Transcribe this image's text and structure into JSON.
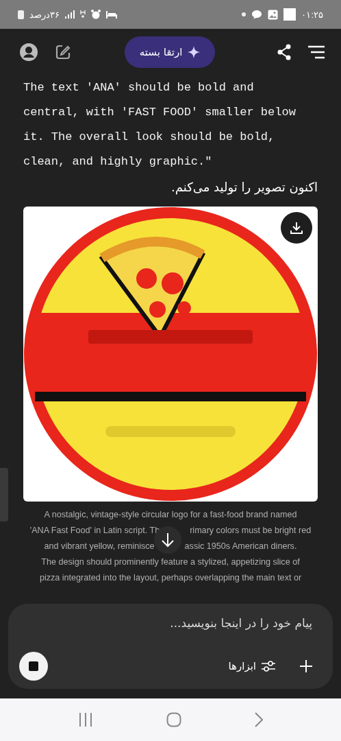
{
  "status_bar": {
    "time": "۰۱:۲۵",
    "battery": "۳۶درصد"
  },
  "header": {
    "upgrade_button": "ارتقا بسته"
  },
  "message": {
    "code_lines": [
      "The text 'ANA' should be bold and",
      "central, with 'FAST FOOD' smaller below",
      "it. The overall look should be bold,",
      "clean, and highly graphic.\""
    ],
    "reply": "اکنون تصویر را تولید می‌کنم.",
    "image": {
      "kind": "picture"
    },
    "caption_lines": [
      {
        "start": "A nostalgic, vintage-style circular logo for a fast-food brand named"
      },
      {
        "start": "'ANA Fast Food' in Latin script. Th",
        "end": "rimary colors must be bright red"
      },
      {
        "start": "and vibrant yellow, reminisce",
        "end": "assic 1950s American diners."
      },
      {
        "start": "The design should prominently feature a stylized, appetizing slice of"
      },
      {
        "start": "pizza integrated into the layout, perhaps overlapping the main text or"
      }
    ]
  },
  "composer": {
    "placeholder": "پیام خود را در اینجا بنویسید...",
    "tools_button": "ابزارها"
  }
}
